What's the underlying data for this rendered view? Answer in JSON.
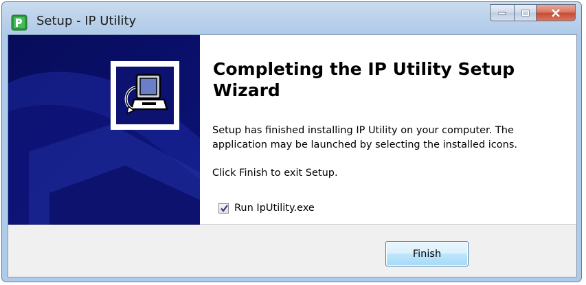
{
  "window": {
    "title": "Setup - IP Utility"
  },
  "wizard": {
    "heading": "Completing the IP Utility Setup Wizard",
    "paragraph1": "Setup has finished installing IP Utility on your computer. The application may be launched by selecting the installed icons.",
    "paragraph2": "Click Finish to exit Setup.",
    "run_checkbox": {
      "label": "Run IpUtility.exe",
      "checked": true
    }
  },
  "buttons": {
    "finish": "Finish"
  },
  "icons": {
    "app": "setup-app-icon",
    "banner": "computer-install-icon"
  },
  "colors": {
    "sidebar": "#0a0f6b",
    "finish_border": "#3c7fb1",
    "close_button": "#c74a33"
  }
}
